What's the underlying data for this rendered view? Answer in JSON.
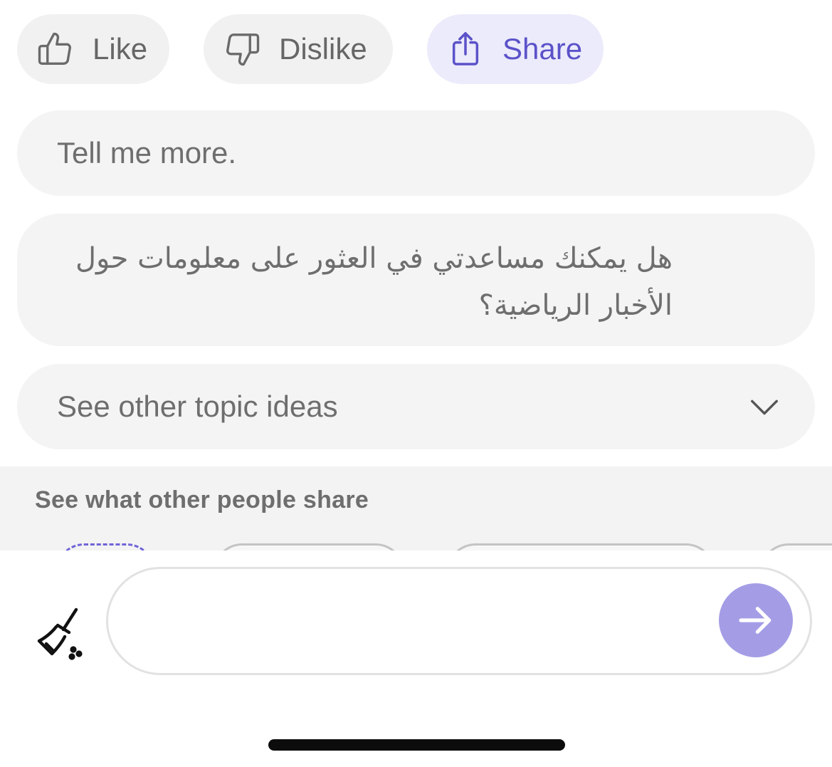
{
  "reactions": {
    "like_label": "Like",
    "dislike_label": "Dislike",
    "share_label": "Share",
    "share_accent": "#5b52c9",
    "like_icon": "thumbs-up-icon",
    "dislike_icon": "thumbs-down-icon",
    "share_icon": "share-icon"
  },
  "suggestions": [
    {
      "text": "Tell me more."
    },
    {
      "text": "هل يمكنك مساعدتي في العثور على معلومات حول الأخبار الرياضية؟"
    },
    {
      "text": "See other topic ideas"
    }
  ],
  "share_section": {
    "heading": "See what other people share"
  },
  "composer": {
    "value": "",
    "placeholder": "",
    "clear_icon": "broom-icon",
    "send_icon": "arrow-right-icon",
    "send_color": "#a49de6"
  }
}
